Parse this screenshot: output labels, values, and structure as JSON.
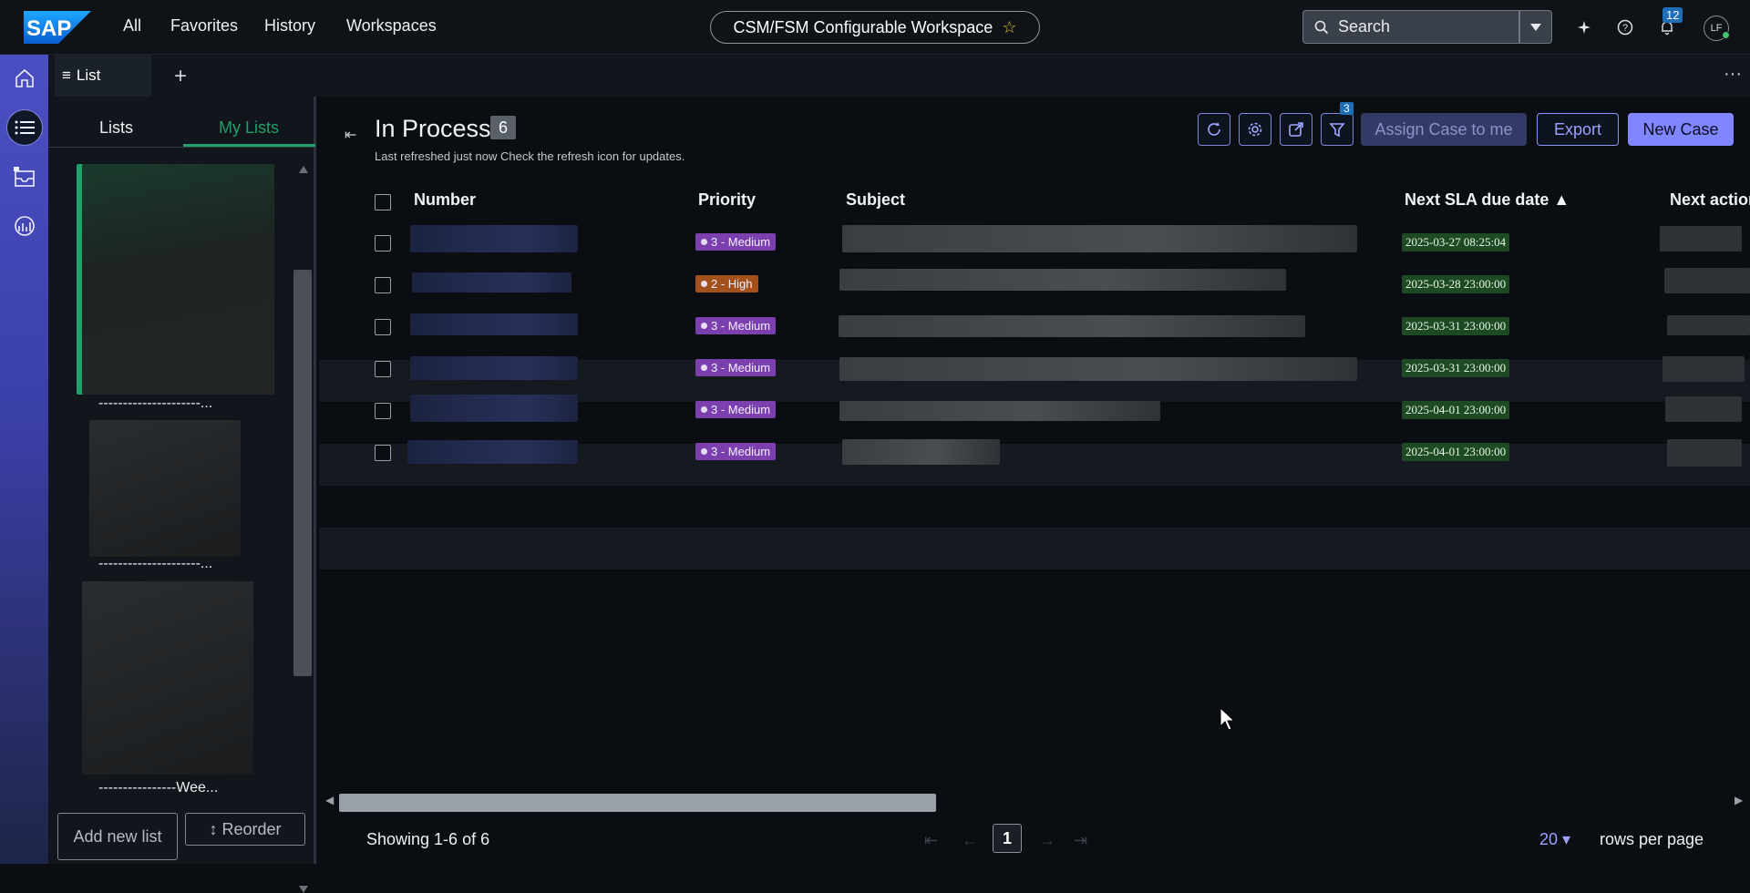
{
  "topbar": {
    "logo_text": "SAP",
    "nav": [
      "All",
      "Favorites",
      "History",
      "Workspaces"
    ],
    "workspace_title": "CSM/FSM Configurable Workspace",
    "search_placeholder": "Search",
    "notification_count": "12",
    "avatar_initials": "LF"
  },
  "rail": {
    "items": [
      "home-icon",
      "list-icon",
      "inbox-icon",
      "analytics-icon"
    ],
    "active": "list-icon"
  },
  "tabs": {
    "items": [
      {
        "label": "List"
      }
    ],
    "add_label": "+",
    "more_label": "···"
  },
  "lists_panel": {
    "tabs": [
      "Lists",
      "My Lists"
    ],
    "active_tab": "My Lists",
    "active_color": "#22a06b",
    "cards": [
      {
        "label": "---------------------..."
      },
      {
        "label": "---------------------..."
      },
      {
        "label": "----------------Wee..."
      }
    ],
    "add_button": "Add new list",
    "reorder_button": "↕ Reorder"
  },
  "main": {
    "title": "In Process",
    "count": "6",
    "refresh_note": "Last refreshed just now Check the refresh icon for updates.",
    "filter_count": "3",
    "assign_button": "Assign Case to me",
    "export_button": "Export",
    "new_button": "New Case",
    "accent": "#7f86ff",
    "columns": [
      "Number",
      "Priority",
      "Subject",
      "Next SLA due date ▲",
      "Next action"
    ],
    "rows": [
      {
        "priority": "3 - Medium",
        "level": "medium",
        "sla": "2025-03-27 08:25:04"
      },
      {
        "priority": "2 - High",
        "level": "high",
        "sla": "2025-03-28 23:00:00"
      },
      {
        "priority": "3 - Medium",
        "level": "medium",
        "sla": "2025-03-31 23:00:00"
      },
      {
        "priority": "3 - Medium",
        "level": "medium",
        "sla": "2025-03-31 23:00:00"
      },
      {
        "priority": "3 - Medium",
        "level": "medium",
        "sla": "2025-04-01 23:00:00"
      },
      {
        "priority": "3 - Medium",
        "level": "medium",
        "sla": "2025-04-01 23:00:00"
      }
    ],
    "showing": "Showing 1-6 of 6",
    "current_page": "1",
    "rows_per_page_value": "20",
    "rows_per_page_label": "rows per page"
  }
}
